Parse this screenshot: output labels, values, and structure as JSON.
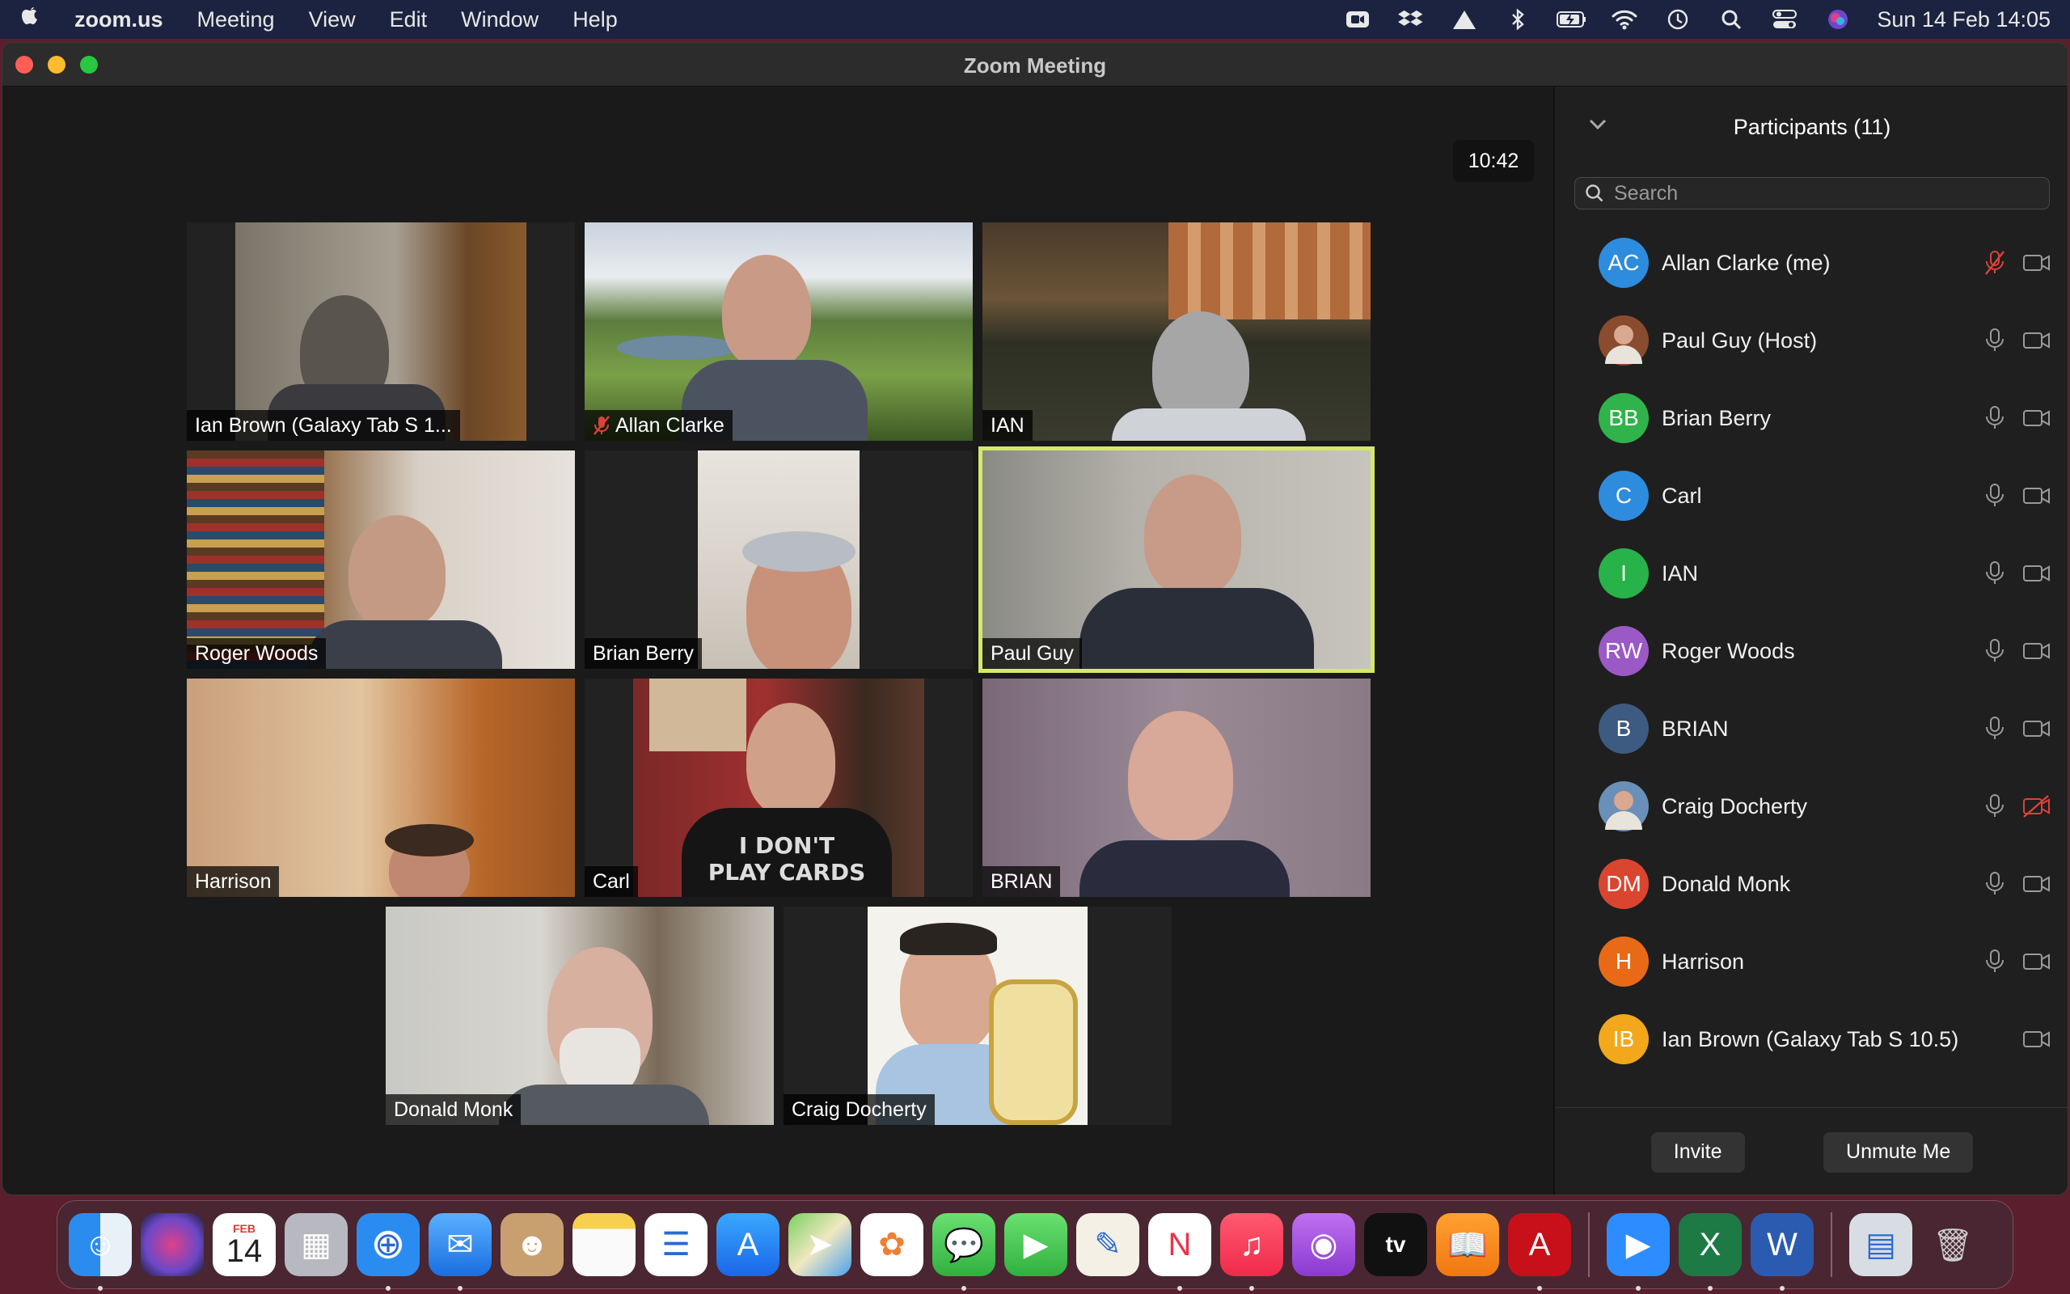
{
  "menubar": {
    "apple": "",
    "app_name": "zoom.us",
    "menus": [
      "Meeting",
      "View",
      "Edit",
      "Window",
      "Help"
    ],
    "clock": "Sun 14 Feb  14:05"
  },
  "window": {
    "title": "Zoom Meeting"
  },
  "timer": "10:42",
  "tiles": [
    {
      "name": "Ian Brown (Galaxy Tab S 1...",
      "muted": false
    },
    {
      "name": "Allan Clarke",
      "muted": true
    },
    {
      "name": "IAN",
      "muted": false
    },
    {
      "name": "Roger Woods",
      "muted": false
    },
    {
      "name": "Brian Berry",
      "muted": false
    },
    {
      "name": "Paul Guy",
      "muted": false,
      "active_speaker": true
    },
    {
      "name": "Harrison",
      "muted": false
    },
    {
      "name": "Carl",
      "muted": false
    },
    {
      "name": "BRIAN",
      "muted": false
    },
    {
      "name": "Donald Monk",
      "muted": false
    },
    {
      "name": "Craig Docherty",
      "muted": false
    }
  ],
  "participants_panel": {
    "title": "Participants (11)",
    "search_placeholder": "Search",
    "participants": [
      {
        "initials": "AC",
        "name": "Allan Clarke (me)",
        "color": "#2d8cde",
        "mic": "muted",
        "video": "on"
      },
      {
        "initials": "",
        "name": "Paul Guy (Host)",
        "color": "#8a4b2e",
        "mic": "on",
        "video": "on",
        "photo": true
      },
      {
        "initials": "BB",
        "name": "Brian Berry",
        "color": "#2fb34a",
        "mic": "on",
        "video": "on"
      },
      {
        "initials": "C",
        "name": "Carl",
        "color": "#2d8cde",
        "mic": "on",
        "video": "on"
      },
      {
        "initials": "I",
        "name": "IAN",
        "color": "#27b24a",
        "mic": "on",
        "video": "on"
      },
      {
        "initials": "RW",
        "name": "Roger Woods",
        "color": "#9b59c6",
        "mic": "on",
        "video": "on"
      },
      {
        "initials": "B",
        "name": "BRIAN",
        "color": "#3d5a80",
        "mic": "on",
        "video": "on"
      },
      {
        "initials": "",
        "name": "Craig Docherty",
        "color": "#6a8fb8",
        "mic": "on",
        "video": "off",
        "photo": true
      },
      {
        "initials": "DM",
        "name": "Donald Monk",
        "color": "#d9452f",
        "mic": "on",
        "video": "on"
      },
      {
        "initials": "H",
        "name": "Harrison",
        "color": "#e86a17",
        "mic": "on",
        "video": "on"
      },
      {
        "initials": "IB",
        "name": "Ian Brown (Galaxy Tab S 10.5)",
        "color": "#f2a81a",
        "mic": "none",
        "video": "on"
      }
    ],
    "invite_label": "Invite",
    "unmute_label": "Unmute Me"
  },
  "dock": {
    "calendar_month": "FEB",
    "calendar_day": "14",
    "apps": [
      "finder-icon",
      "siri-icon",
      "calendar-icon",
      "launchpad-icon",
      "safari-icon",
      "mail-icon",
      "contacts-icon",
      "notes-icon",
      "reminders-icon",
      "appstore-icon",
      "maps-icon",
      "photos-icon",
      "messages-icon",
      "facetime-icon",
      "pages-icon",
      "news-icon",
      "music-icon",
      "podcasts-icon",
      "appletv-icon",
      "books-icon",
      "acrobat-icon",
      "zoom-icon",
      "excel-icon",
      "word-icon",
      "preview-icon",
      "trash-icon"
    ],
    "appletv_label": "tv"
  }
}
